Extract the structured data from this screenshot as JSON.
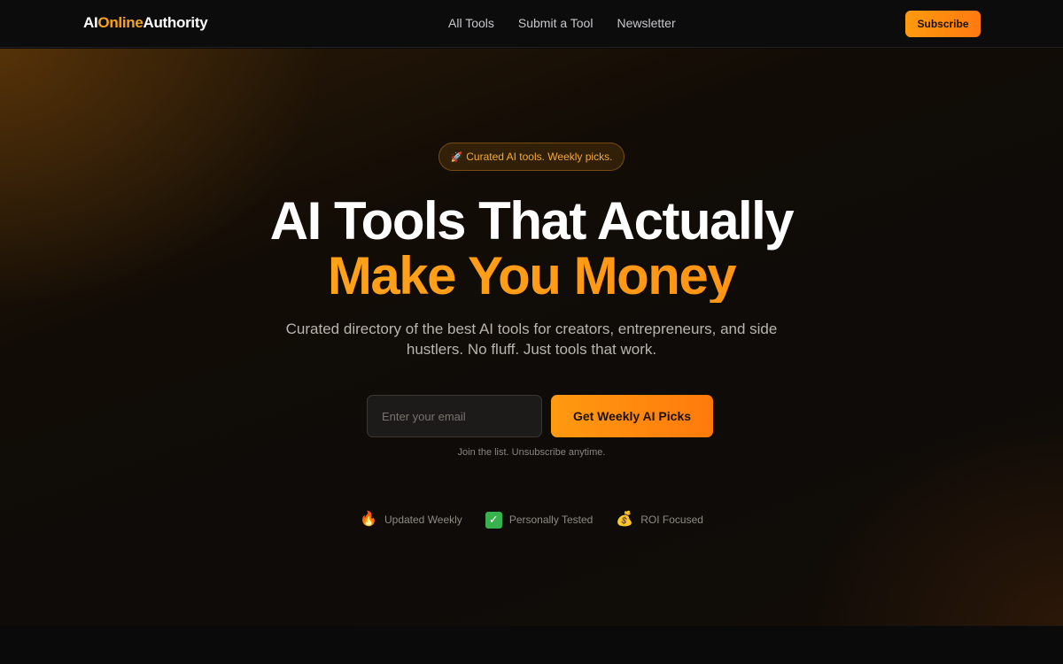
{
  "nav": {
    "logo": {
      "part1": "AI",
      "part2": "Online",
      "part3": "Authority"
    },
    "links": [
      "All Tools",
      "Submit a Tool",
      "Newsletter"
    ],
    "subscribe_label": "Subscribe"
  },
  "hero": {
    "badge_icon": "🚀",
    "badge_text": "Curated AI tools. Weekly picks.",
    "headline_line1": "AI Tools That Actually",
    "headline_line2": "Make You Money",
    "subtext": "Curated directory of the best AI tools for creators, entrepreneurs, and side hustlers. No fluff. Just tools that work.",
    "email_placeholder": "Enter your email",
    "email_value": "",
    "cta_label": "Get Weekly AI Picks",
    "note": "Join the list. Unsubscribe anytime.",
    "features": [
      {
        "icon": "🔥",
        "icon_name": "fire-icon",
        "label": "Updated Weekly"
      },
      {
        "icon": "✓",
        "icon_name": "check-icon",
        "label": "Personally Tested"
      },
      {
        "icon": "💰",
        "icon_name": "money-bag-icon",
        "label": "ROI Focused"
      }
    ]
  },
  "colors": {
    "accent": "#ff9a10",
    "accent_alt": "#ff7a0c",
    "background": "#0b0b0c",
    "check_green": "#37b24d"
  }
}
